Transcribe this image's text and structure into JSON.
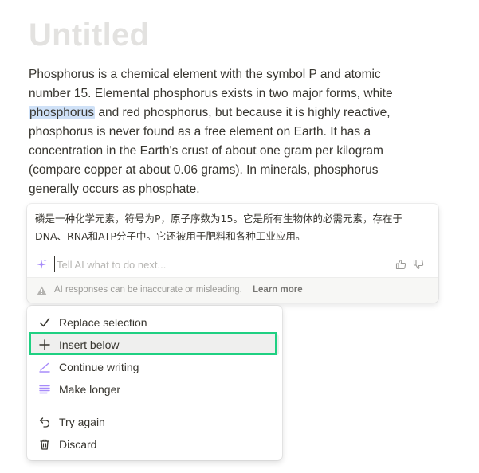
{
  "document": {
    "title": "Untitled",
    "paragraph_before": "Phosphorus is a chemical element with the symbol P and atomic number 15. Elemental phosphorus exists in two major forms, white ",
    "selected_word": "phosphorus",
    "paragraph_after": " and red phosphorus, but because it is highly reactive, phosphorus is never found as a free element on Earth. It has a concentration in the Earth's crust of about one gram per kilogram (compare copper at about 0.06 grams). In minerals, phosphorus generally occurs as phosphate."
  },
  "ai_panel": {
    "response": "磷是一种化学元素，符号为P，原子序数为15。它是所有生物体的必需元素，存在于DNA、RNA和ATP分子中。它还被用于肥料和各种工业应用。",
    "input_placeholder": "Tell AI what to do next...",
    "input_value": "",
    "disclaimer": "AI responses can be inaccurate or misleading.",
    "learn_more": "Learn more"
  },
  "menu": {
    "items": [
      {
        "label": "Replace selection",
        "icon": "check-icon"
      },
      {
        "label": "Insert below",
        "icon": "plus-icon"
      },
      {
        "label": "Continue writing",
        "icon": "pen-line-icon"
      },
      {
        "label": "Make longer",
        "icon": "lines-icon"
      }
    ],
    "secondary_items": [
      {
        "label": "Try again",
        "icon": "retry-icon"
      },
      {
        "label": "Discard",
        "icon": "trash-icon"
      }
    ],
    "highlighted_item": "Insert below"
  },
  "colors": {
    "selection_highlight": "#cfe1f7",
    "focus_outline": "#1fd082",
    "ai_accent": "#a78bfa",
    "text": "#37352f",
    "muted": "#9b9a97"
  }
}
